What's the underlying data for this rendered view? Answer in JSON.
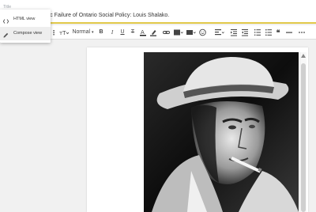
{
  "title_bar": {
    "label": "Title",
    "title": "...atic Failure of Ontario Social Policy: Louis Shalako."
  },
  "mode_menu": {
    "items": [
      {
        "label": "HTML view",
        "icon": "code-icon"
      },
      {
        "label": "Compose view",
        "icon": "pencil-icon"
      }
    ],
    "active_index": 1
  },
  "toolbar": {
    "format_value": "Normal",
    "buttons": [
      "undo-icon",
      "redo-icon",
      "font-icon",
      "font-size-icon",
      "format-select",
      "bold-icon",
      "italic-icon",
      "underline-icon",
      "strikethrough-icon",
      "text-color-icon",
      "highlight-icon",
      "link-icon",
      "image-icon",
      "video-icon",
      "emoji-icon",
      "align-icon",
      "indent-icon",
      "outdent-icon",
      "numbered-list-icon",
      "bulleted-list-icon",
      "quote-icon",
      "clear-format-icon",
      "more-icon"
    ]
  },
  "editor": {
    "image_alt": "black-and-white sketch of man in fedora smoking a cigarette"
  }
}
